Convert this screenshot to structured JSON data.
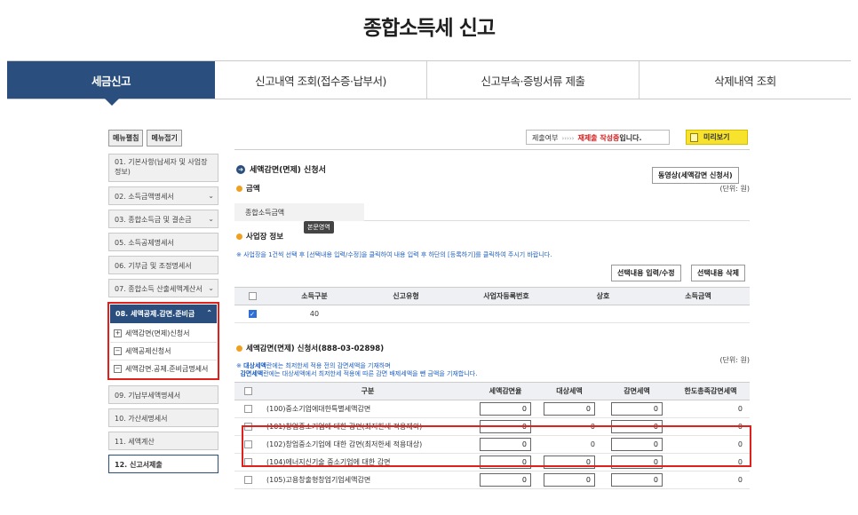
{
  "page_title": "종합소득세 신고",
  "tabs": [
    {
      "label": "세금신고",
      "active": true
    },
    {
      "label": "신고내역 조회(접수증·납부서)",
      "active": false
    },
    {
      "label": "신고부속·증빙서류 제출",
      "active": false
    },
    {
      "label": "삭제내역 조회",
      "active": false
    }
  ],
  "sidebar": {
    "expand_label": "메뉴펼침",
    "collapse_label": "메뉴접기",
    "items": [
      {
        "label": "01. 기본사항(납세자 및 사업장정보)"
      },
      {
        "label": "02. 소득금액명세서"
      },
      {
        "label": "03. 종합소득금 및 결손금"
      },
      {
        "label": "05. 소득공제명세서"
      },
      {
        "label": "06. 기부금 및 조정명세서"
      },
      {
        "label": "07. 종합소득 산출세액계산서"
      }
    ],
    "selected_group": {
      "label": "08. 세액공제.감면.준비금",
      "subitems": [
        {
          "label": "세액감면(면제)신청서",
          "mark": "+"
        },
        {
          "label": "세액공제신청서",
          "mark": "−"
        },
        {
          "label": "세액감면.공제.준비금명세서",
          "mark": "−"
        }
      ]
    },
    "items_after": [
      {
        "label": "09. 기납부세액명세서"
      },
      {
        "label": "10. 가산세명세서"
      },
      {
        "label": "11. 세액계산"
      },
      {
        "label": "12. 신고서제출"
      }
    ]
  },
  "status": {
    "prefix": "제출여부",
    "arrows": "›››››",
    "state": "재제출 작성중",
    "suffix": "입니다."
  },
  "preview_label": "미리보기",
  "section_title": "세액감면(면제) 신청서",
  "video_button": "동영상(세액감면 신청서)",
  "amount": {
    "title": "금액",
    "unit": "(단위: 원)",
    "label": "종합소득금액",
    "value": ""
  },
  "tooltip": "본문영역",
  "business": {
    "title": "사업장 정보",
    "note": "※ 사업장을 1건씩 선택 후 [선택내용 입력/수정]을 클릭하여 내용 입력 후 하단의 [등록하기]를 클릭하여 주시기 바랍니다.",
    "btn_edit": "선택내용 입력/수정",
    "btn_delete": "선택내용 삭제",
    "headers": [
      "소득구분",
      "신고유형",
      "사업자등록번호",
      "상호",
      "소득금액"
    ],
    "rows": [
      {
        "checked": true,
        "income_type": "40",
        "report_type": "",
        "biz_no": "",
        "name": "",
        "amount": ""
      }
    ]
  },
  "reduction": {
    "title": "세액감면(면제) 신청서(888-03-02898)",
    "unit": "(단위: 원)",
    "note_line1_bold": "대상세액",
    "note_line1_rest": "란에는 최저한세 적용 전의 감면세액을 기재하며",
    "note_line2_bold": "감면세액",
    "note_line2_rest": "란에는 대상세액에서 최저한세 적용에 따른 감면 배제세액을 뺀 금액을 기재합니다.",
    "note_prefix": "※",
    "headers": [
      "구분",
      "세액감면율",
      "대상세액",
      "감면세액",
      "한도총족감면세액"
    ],
    "rows": [
      {
        "label": "(100)중소기업에대한특별세액감면",
        "rate": "0",
        "target": "0",
        "reduced": "0",
        "limit": "0"
      },
      {
        "label": "(101)창업중소기업에 대한 감면(최저한세 적용제외)",
        "rate": "0",
        "target": "0",
        "reduced": "0",
        "limit": "0"
      },
      {
        "label": "(102)창업중소기업에 대한 감면(최저한세 적용대상)",
        "rate": "0",
        "target": "0",
        "reduced": "0",
        "limit": "0"
      },
      {
        "label": "(104)에너지신기술 중소기업에 대한 감면",
        "rate": "0",
        "target": "0",
        "reduced": "0",
        "limit": "0"
      },
      {
        "label": "(105)고용창출형창업기업세액감면",
        "rate": "0",
        "target": "0",
        "reduced": "0",
        "limit": "0"
      }
    ]
  }
}
